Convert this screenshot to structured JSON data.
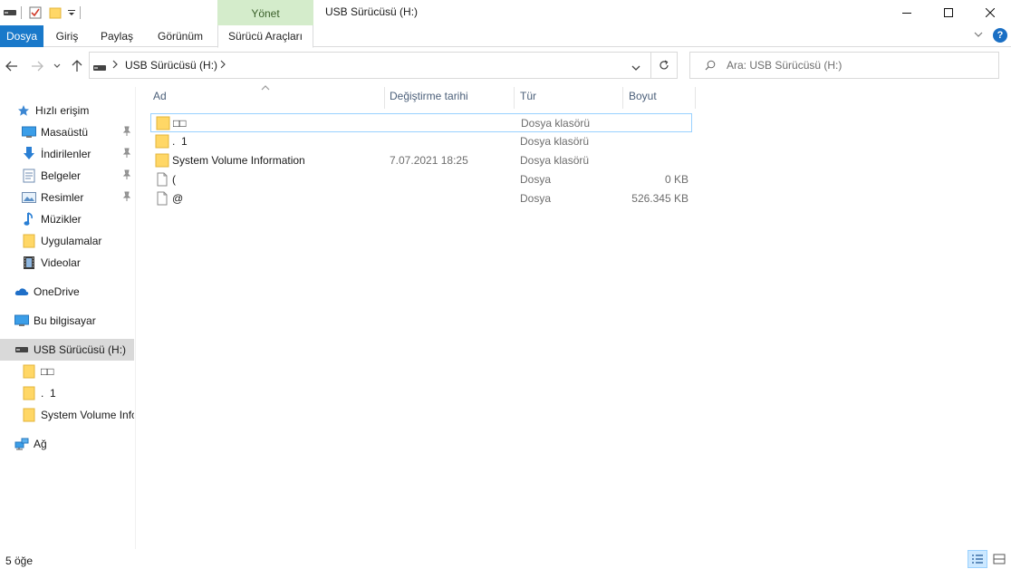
{
  "window": {
    "title": "USB Sürücüsü (H:)",
    "context_tab": "Yönet"
  },
  "ribbon": {
    "tabs": [
      "Dosya",
      "Giriş",
      "Paylaş",
      "Görünüm",
      "Sürücü Araçları"
    ]
  },
  "address": {
    "path": [
      "USB Sürücüsü (H:)"
    ]
  },
  "search": {
    "placeholder": "Ara: USB Sürücüsü (H:)"
  },
  "nav": {
    "quick_access": "Hızlı erişim",
    "quick_items": [
      {
        "label": "Masaüstü",
        "icon": "desktop-icon"
      },
      {
        "label": "İndirilenler",
        "icon": "downloads-icon"
      },
      {
        "label": "Belgeler",
        "icon": "documents-icon"
      },
      {
        "label": "Resimler",
        "icon": "pictures-icon"
      },
      {
        "label": "Müzikler",
        "icon": "music-icon"
      },
      {
        "label": "Uygulamalar",
        "icon": "folder-icon"
      },
      {
        "label": "Videolar",
        "icon": "videos-icon"
      }
    ],
    "onedrive": "OneDrive",
    "this_pc": "Bu bilgisayar",
    "usb": "USB Sürücüsü (H:)",
    "usb_children": [
      "□□",
      ".  1",
      "System Volume Information"
    ],
    "network": "Ağ"
  },
  "columns": {
    "name": "Ad",
    "modified": "Değiştirme tarihi",
    "type": "Tür",
    "size": "Boyut"
  },
  "files": [
    {
      "name": "□□",
      "modified": "",
      "type": "Dosya klasörü",
      "size": "",
      "kind": "folder"
    },
    {
      "name": ".  1",
      "modified": "",
      "type": "Dosya klasörü",
      "size": "",
      "kind": "folder"
    },
    {
      "name": "System Volume Information",
      "modified": "7.07.2021 18:25",
      "type": "Dosya klasörü",
      "size": "",
      "kind": "folder"
    },
    {
      "name": "(",
      "modified": "",
      "type": "Dosya",
      "size": "0 KB",
      "kind": "file"
    },
    {
      "name": "@",
      "modified": "",
      "type": "Dosya",
      "size": "526.345 KB",
      "kind": "file"
    }
  ],
  "status": {
    "count": "5 öğe"
  },
  "colors": {
    "accent": "#1979ca",
    "context_tab_bg": "#d4eccb",
    "selection": "#cce8ff",
    "folder": "#ffd766"
  }
}
